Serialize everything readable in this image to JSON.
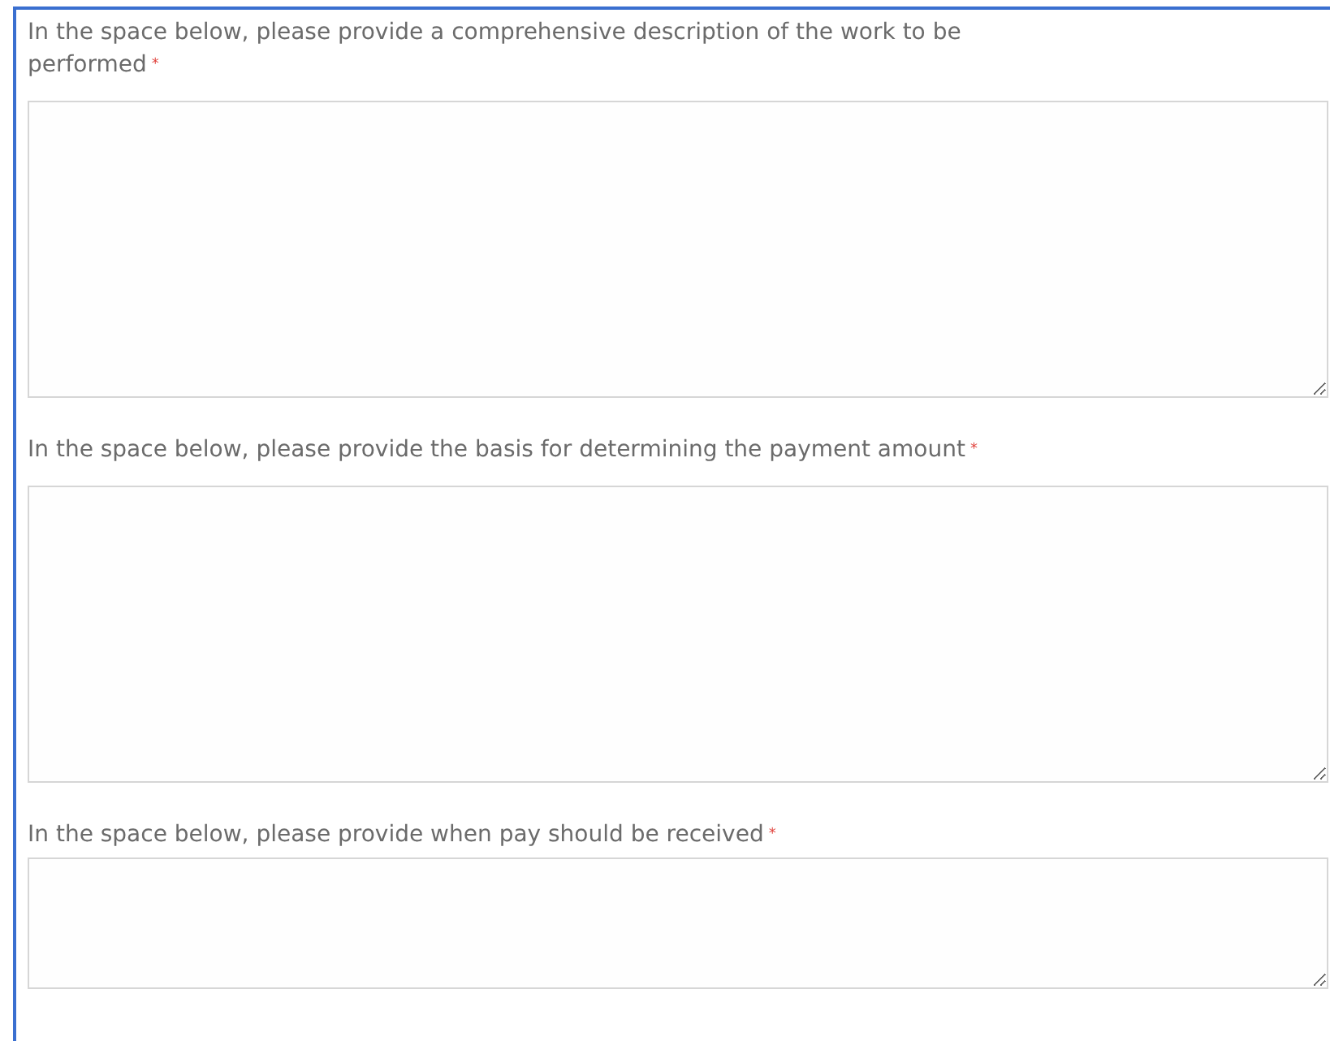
{
  "fields": [
    {
      "label": "In the space below, please provide a comprehensive description of the work to be performed",
      "required_mark": "*",
      "kind": "large"
    },
    {
      "label": "In the space below, please provide the basis for determining the payment amount",
      "required_mark": "*",
      "kind": "large"
    },
    {
      "label": "In the space below, please provide when pay should be received",
      "required_mark": "*",
      "kind": "small"
    }
  ]
}
